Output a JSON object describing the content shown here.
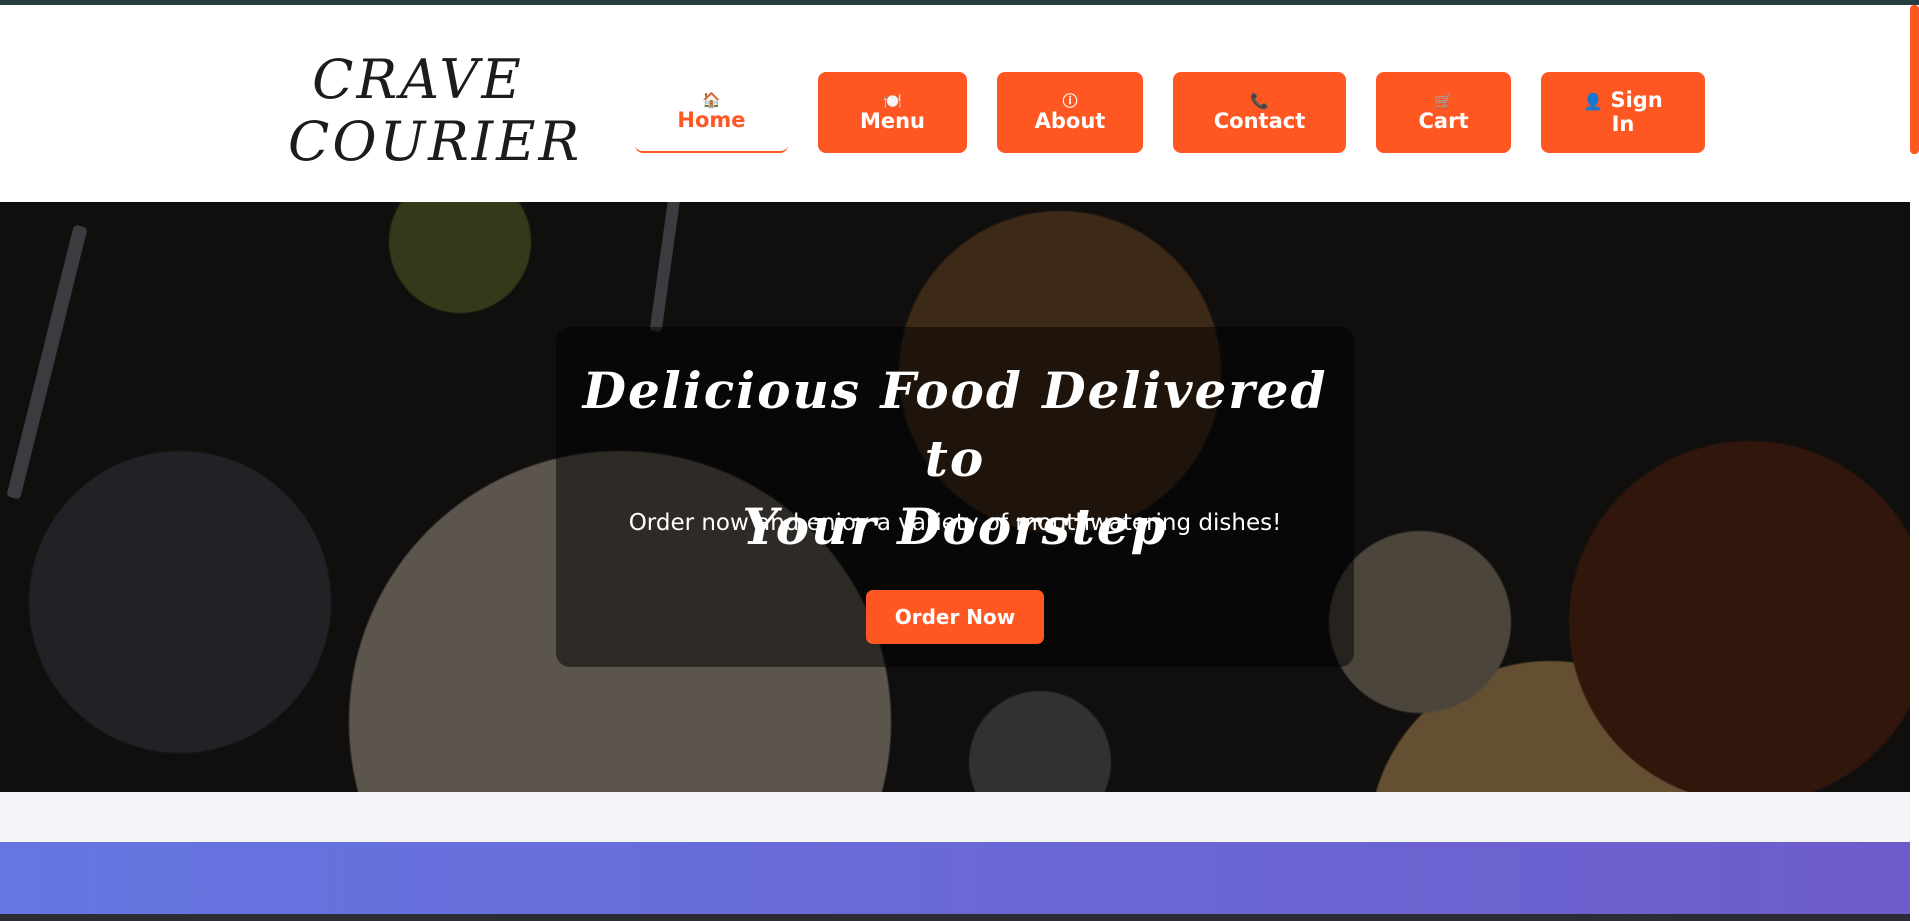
{
  "brand": {
    "line1": "CRAVE",
    "line2": "COURIER"
  },
  "nav": {
    "home": {
      "label": "Home",
      "icon": "🏠",
      "icon_name": "home-icon"
    },
    "menu": {
      "label": "Menu",
      "icon": "🍽️",
      "icon_name": "plate-icon"
    },
    "about": {
      "label": "About",
      "icon": "ⓘ",
      "icon_name": "info-icon"
    },
    "contact": {
      "label": "Contact",
      "icon": "📞",
      "icon_name": "phone-icon"
    },
    "cart": {
      "label": "Cart",
      "icon": "🛒",
      "icon_name": "cart-icon"
    },
    "signin": {
      "label_line1": "Sign",
      "label_line2": "In",
      "icon": "👤",
      "icon_name": "user-icon"
    }
  },
  "hero": {
    "title_line1": "Delicious Food Delivered to",
    "title_line2": "Your Doorstep",
    "subtitle": "Order now and enjoy a variety of mouthwatering dishes!",
    "cta_label": "Order Now"
  },
  "colors": {
    "accent": "#ff5722",
    "band_start": "#6576e0",
    "band_end": "#6e5ccc",
    "topline": "#263d40"
  }
}
